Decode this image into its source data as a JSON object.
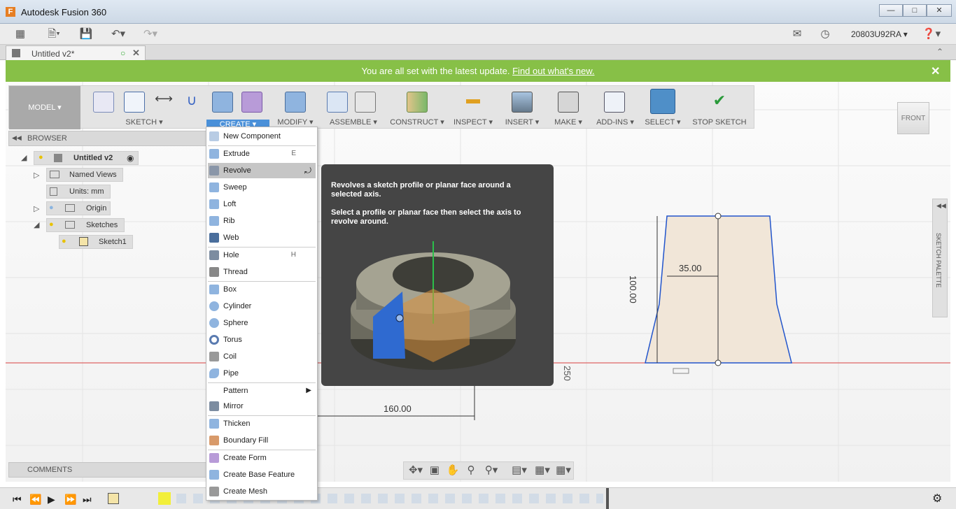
{
  "window": {
    "title": "Autodesk Fusion 360",
    "logo": "F"
  },
  "toolbar": {
    "user": "20803U92RA"
  },
  "tab": {
    "title": "Untitled v2*"
  },
  "banner": {
    "text": "You are all set with the latest update.",
    "link": "Find out what's new."
  },
  "ribbon": {
    "model": "MODEL ▾",
    "groups": [
      "SKETCH ▾",
      "CREATE ▾",
      "MODIFY ▾",
      "ASSEMBLE ▾",
      "CONSTRUCT ▾",
      "INSPECT ▾",
      "INSERT ▾",
      "MAKE ▾",
      "ADD-INS ▾",
      "SELECT ▾",
      "STOP SKETCH"
    ]
  },
  "browser": {
    "title": "BROWSER",
    "nodes": [
      "Untitled v2",
      "Named Views",
      "Units: mm",
      "Origin",
      "Sketches",
      "Sketch1"
    ]
  },
  "comments": {
    "label": "COMMENTS"
  },
  "create_menu": {
    "items": [
      {
        "label": "New Component",
        "shortcut": ""
      },
      {
        "label": "Extrude",
        "shortcut": "E"
      },
      {
        "label": "Revolve",
        "shortcut": ""
      },
      {
        "label": "Sweep",
        "shortcut": ""
      },
      {
        "label": "Loft",
        "shortcut": ""
      },
      {
        "label": "Rib",
        "shortcut": ""
      },
      {
        "label": "Web",
        "shortcut": ""
      },
      {
        "label": "Hole",
        "shortcut": "H"
      },
      {
        "label": "Thread",
        "shortcut": ""
      },
      {
        "label": "Box",
        "shortcut": ""
      },
      {
        "label": "Cylinder",
        "shortcut": ""
      },
      {
        "label": "Sphere",
        "shortcut": ""
      },
      {
        "label": "Torus",
        "shortcut": ""
      },
      {
        "label": "Coil",
        "shortcut": ""
      },
      {
        "label": "Pipe",
        "shortcut": ""
      },
      {
        "label": "Pattern",
        "shortcut": ""
      },
      {
        "label": "Mirror",
        "shortcut": ""
      },
      {
        "label": "Thicken",
        "shortcut": ""
      },
      {
        "label": "Boundary Fill",
        "shortcut": ""
      },
      {
        "label": "Create Form",
        "shortcut": ""
      },
      {
        "label": "Create Base Feature",
        "shortcut": ""
      },
      {
        "label": "Create Mesh",
        "shortcut": ""
      }
    ]
  },
  "tooltip": {
    "line1": "Revolves a sketch profile or planar face around a selected axis.",
    "line2": "Select a profile or planar face then select the axis to revolve around."
  },
  "sketch": {
    "dim_width": "35.00",
    "dim_height": "100.00",
    "dim_bottom": "160.00",
    "dim_side": "250"
  },
  "viewcube": {
    "label": "FRONT"
  },
  "palette": {
    "label": "SKETCH PALETTE"
  },
  "colors": {
    "banner": "#87c047",
    "accent": "#4a90d9",
    "sketch_line": "#2255cc",
    "axis": "#d94040"
  }
}
